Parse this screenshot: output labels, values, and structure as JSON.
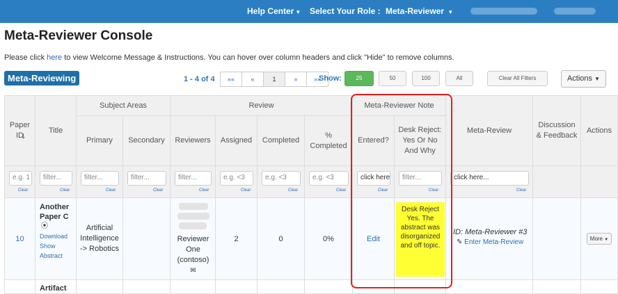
{
  "topbar": {
    "help_center": "Help Center",
    "select_role": "Select Your Role :",
    "role": "Meta-Reviewer"
  },
  "page_title": "Meta-Reviewer Console",
  "intro": {
    "before": "Please click ",
    "link": "here",
    "after": " to view Welcome Message & Instructions. You can hover over column headers and click \"Hide\" to remove columns."
  },
  "badge": "Meta-Reviewing",
  "pagination": {
    "count": "1 - 4 of 4",
    "first": "««",
    "prev": "«",
    "page": "1",
    "next": "»",
    "last": "»»"
  },
  "show": {
    "label": "Show:",
    "options": [
      "25",
      "50",
      "100",
      "All"
    ]
  },
  "clear_filters": "Clear All Filters",
  "actions_button": "Actions",
  "table": {
    "groups": {
      "subject_areas": "Subject Areas",
      "review": "Review",
      "meta_note": "Meta-Reviewer Note"
    },
    "columns": {
      "paper_id": "Paper ID",
      "title": "Title",
      "primary": "Primary",
      "secondary": "Secondary",
      "reviewers": "Reviewers",
      "assigned": "Assigned",
      "completed": "Completed",
      "pct_completed": "% Completed",
      "entered": "Entered?",
      "desk_reject": "Desk Reject: Yes Or No And Why",
      "meta_review": "Meta-Review",
      "discussion": "Discussion & Feedback",
      "actions": "Actions"
    },
    "filters": {
      "paper_id": "e.g. 1",
      "title": "filter...",
      "primary": "filter...",
      "secondary": "filter...",
      "reviewers": "filter...",
      "assigned": "e.g. <3",
      "completed": "e.g. <3",
      "pct": "e.g. <3",
      "entered": "click here",
      "desk_reject": "filter...",
      "meta_review": "click here...",
      "clear": "Clear"
    },
    "row1": {
      "paper_id": "10",
      "title": "Another Paper C",
      "download": "Download",
      "show_abstract": "Show Abstract",
      "primary": "Artificial Intelligence -> Robotics",
      "reviewer_line1": "Reviewer",
      "reviewer_line2": "One",
      "reviewer_line3": "(contoso)",
      "assigned": "2",
      "completed": "0",
      "pct": "0%",
      "entered": "Edit",
      "note": "Desk Reject Yes. The abstract was disorganized and off topic.",
      "meta_id": "ID: Meta-Reviewer #3",
      "enter_meta": "Enter Meta-Review",
      "more": "More"
    },
    "row2": {
      "title": "Artifact"
    }
  }
}
